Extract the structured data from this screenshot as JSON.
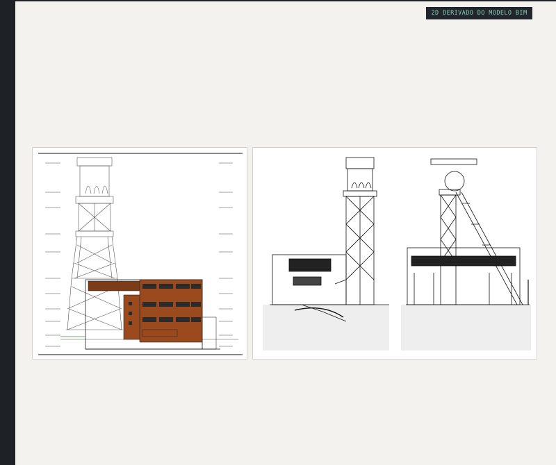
{
  "badge": {
    "label": "2D DERIVADO DO MODELO BIM"
  },
  "colors": {
    "brick": "#9a4a1c",
    "ink": "#111111",
    "ground_fill": "#eeeeee",
    "badge_text": "#8ecfb7",
    "sidebar": "#1e2226"
  },
  "panels": [
    {
      "name": "elevation-drawing"
    },
    {
      "name": "section-drawings"
    }
  ]
}
